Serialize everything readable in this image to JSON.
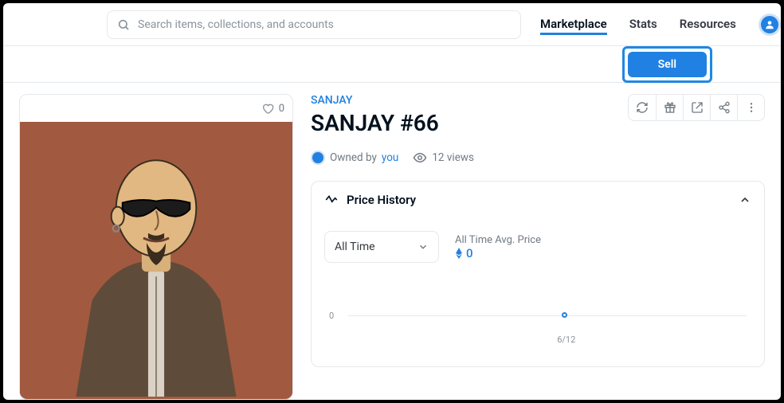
{
  "header": {
    "search_placeholder": "Search items, collections, and accounts",
    "nav": {
      "marketplace": "Marketplace",
      "stats": "Stats",
      "resources": "Resources"
    }
  },
  "sell": {
    "label": "Sell"
  },
  "item": {
    "collection": "SANJAY",
    "title": "SANJAY #66",
    "owned_by_prefix": "Owned by",
    "owned_by_link": "you",
    "views": "12 views",
    "favorites": "0"
  },
  "panel": {
    "title": "Price History",
    "range_selected": "All Time",
    "avg_label": "All Time Avg. Price",
    "avg_value": "0"
  },
  "chart_data": {
    "type": "line",
    "x": [
      "6/12"
    ],
    "values": [
      0
    ],
    "ylabel": "",
    "xlabel": "",
    "ylim": [
      0,
      1
    ],
    "y_tick": "0",
    "x_tick": "6/12"
  }
}
